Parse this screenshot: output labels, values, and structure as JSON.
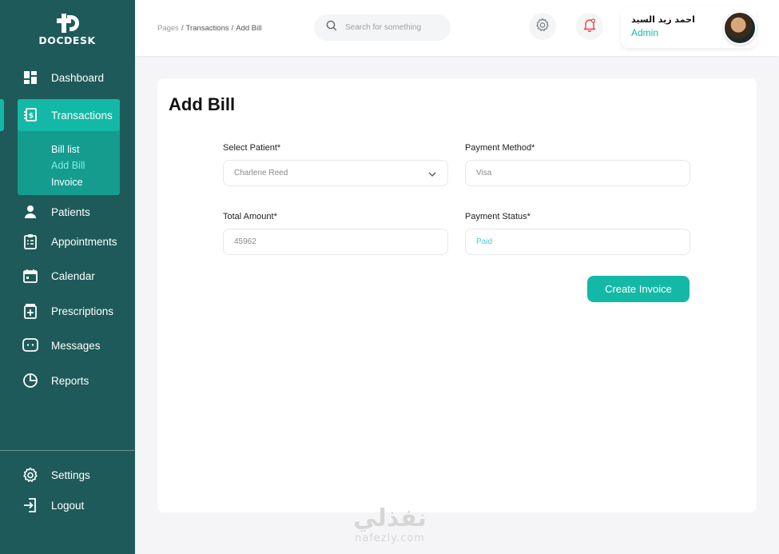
{
  "brand": {
    "name": "DOCDESK"
  },
  "sidebar": {
    "items": [
      {
        "label": "Dashboard",
        "icon": "dashboard-icon"
      },
      {
        "label": "Transactions",
        "icon": "receipt-dollar-icon"
      },
      {
        "label": "Patients",
        "icon": "user-icon"
      },
      {
        "label": "Appointments",
        "icon": "clipboard-icon"
      },
      {
        "label": "Calendar",
        "icon": "calendar-icon"
      },
      {
        "label": "Prescriptions",
        "icon": "prescription-icon"
      },
      {
        "label": "Messages",
        "icon": "message-icon"
      },
      {
        "label": "Reports",
        "icon": "pie-chart-icon"
      }
    ],
    "sub_items": [
      "Bill list",
      "Add Bill",
      "Invoice"
    ],
    "active_sub_index": 1,
    "bottom": [
      {
        "label": "Settings",
        "icon": "gear-icon"
      },
      {
        "label": "Logout",
        "icon": "logout-icon"
      }
    ]
  },
  "header": {
    "breadcrumb": [
      "Pages",
      "Transactions",
      "Add Bill"
    ],
    "search_placeholder": "Search for something",
    "user": {
      "name": "احمد زيد السيد",
      "role": "Admin"
    }
  },
  "form": {
    "title": "Add Bill",
    "fields": {
      "patient": {
        "label": "Select Patient*",
        "value": "Charlene Reed"
      },
      "payment_method": {
        "label": "Payment Method*",
        "value": "Visa"
      },
      "total_amount": {
        "label": "Total Amount*",
        "value": "45962"
      },
      "payment_status": {
        "label": "Payment Status*",
        "value": "Paid"
      }
    },
    "submit_label": "Create Invoice"
  },
  "watermark": {
    "arabic": "نفذلي",
    "latin": "nafezly.com"
  },
  "colors": {
    "sidebar": "#1e5a5a",
    "accent": "#14b8a6",
    "active_sub": "#7ef0e2",
    "notification": "#ef4444"
  }
}
